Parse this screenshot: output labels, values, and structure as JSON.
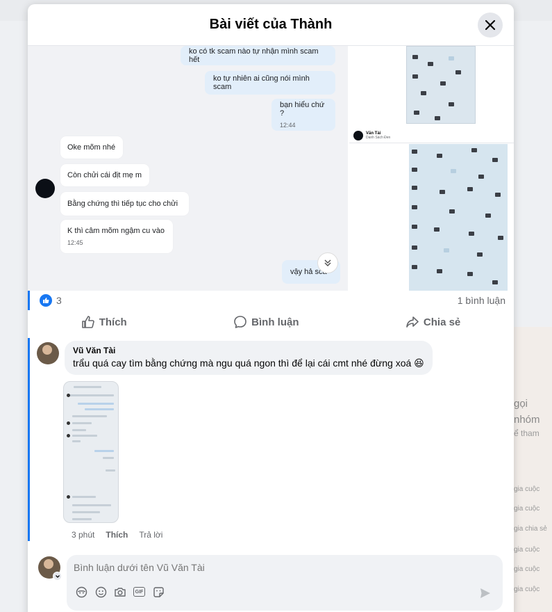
{
  "background": {
    "right_texts": [
      "gọi",
      "nhóm",
      "ể tham",
      "gia cuộc",
      "gia cuộc",
      "gia chia sẻ",
      "gia cuộc",
      "gia cuộc",
      "gia cuộc"
    ]
  },
  "modal": {
    "title": "Bài viết của Thành"
  },
  "screenshot_chat": {
    "outgoing": [
      {
        "text": "ko có tk scam nào tự nhận mình scam hết"
      },
      {
        "text": "ko tự nhiên ai cũng nói mình scam"
      },
      {
        "text": "bạn hiểu chứ ?",
        "time": "12:44"
      }
    ],
    "incoming": [
      {
        "text": "Oke mõm nhé"
      },
      {
        "text": "Còn chửi cái địt mẹ m"
      },
      {
        "text": "Bằng chứng thì tiếp tục cho chửi"
      },
      {
        "text": "K thì câm mõm ngậm cu vào",
        "time": "12:45"
      }
    ],
    "partial_outgoing": "vậy hả sca"
  },
  "screenshot_thumb": {
    "name": "Văn Tài",
    "subtitle": "Danh Sách Đen"
  },
  "stats": {
    "like_count": "3",
    "comment_count": "1 bình luận"
  },
  "actions": {
    "like": "Thích",
    "comment": "Bình luận",
    "share": "Chia sẻ"
  },
  "comment": {
    "author": "Vũ Văn Tài",
    "text": "trẩu quá cay tìm bằng chứng mà ngu quá ngon thì để lại cái cmt nhé đừng xoá 😆",
    "time": "3 phút",
    "like_label": "Thích",
    "reply_label": "Trả lời"
  },
  "composer": {
    "placeholder": "Bình luận dưới tên Vũ Văn Tài",
    "icons": [
      "avatar-sticker-icon",
      "emoji-icon",
      "camera-icon",
      "gif-icon",
      "sticker-icon",
      "send-icon"
    ],
    "gif_label": "GIF"
  },
  "colors": {
    "accent": "#1877f2",
    "bubble_out": "#e2eefa",
    "comment_bg": "#f0f2f5"
  }
}
